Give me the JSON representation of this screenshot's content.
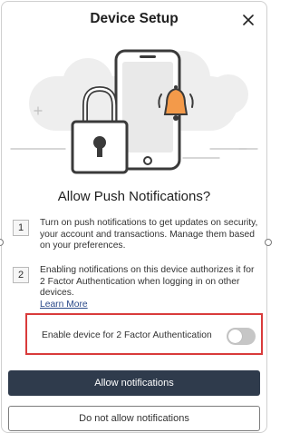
{
  "dialog": {
    "title": "Device Setup",
    "close_icon": "close-icon"
  },
  "illustration": {
    "icons": [
      "phone-icon",
      "bell-icon",
      "padlock-icon"
    ],
    "colors": {
      "bell": "#f39a4a",
      "outline": "#3a3a3a",
      "cloud": "#eeeeee"
    }
  },
  "main": {
    "heading": "Allow Push Notifications?",
    "steps": [
      {
        "number": "1",
        "text": "Turn on push notifications to get updates on security, your account and transactions. Manage them based on your preferences."
      },
      {
        "number": "2",
        "text": "Enabling notifications on this device authorizes it for 2 Factor Authentication when logging in on other devices.",
        "link": "Learn More"
      }
    ],
    "toggle": {
      "label": "Enable device for 2 Factor Authentication",
      "state": "off"
    }
  },
  "buttons": {
    "allow": "Allow notifications",
    "deny": "Do not allow notifications"
  },
  "colors": {
    "primary_button": "#2f3b4c",
    "highlight_border": "#d93b3b"
  }
}
